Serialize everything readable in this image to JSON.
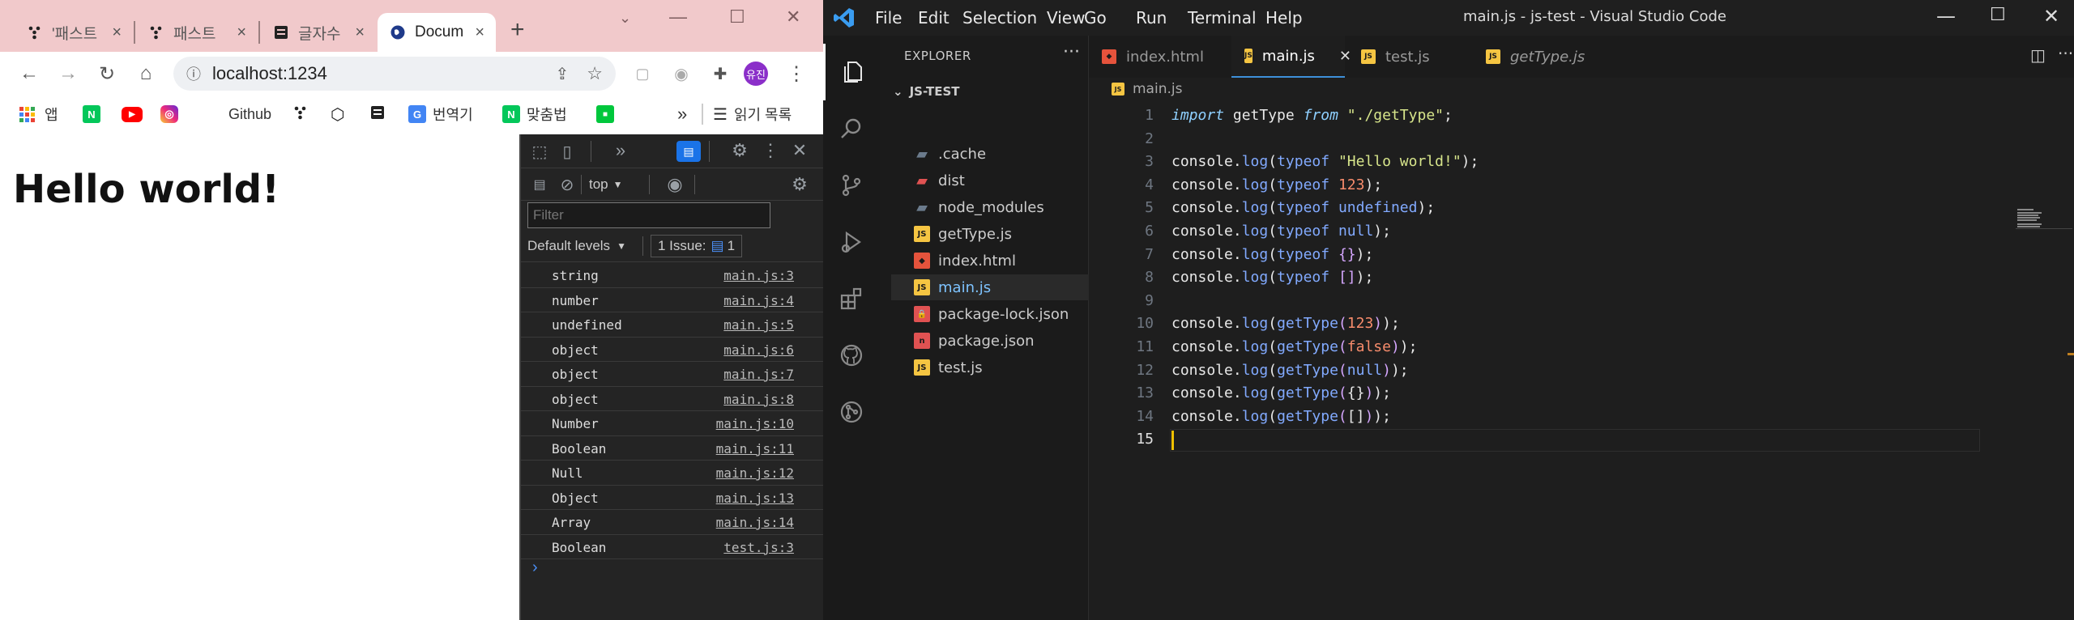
{
  "browser": {
    "tabs": [
      {
        "label": "'패스트",
        "active": false
      },
      {
        "label": "패스트",
        "active": false
      },
      {
        "label": "글자수",
        "active": false
      },
      {
        "label": "Docum",
        "active": true
      }
    ],
    "tab_close_glyph": "×",
    "new_tab_glyph": "+",
    "url": "localhost:1234",
    "profile_initials": "유진",
    "bookmarks": [
      {
        "label": "앱",
        "icon": "apps-grid-icon"
      },
      {
        "label": "",
        "icon": "naver-icon",
        "color": "#03c75a",
        "letter": "N"
      },
      {
        "label": "",
        "icon": "youtube-icon",
        "color": "#ff0000",
        "letter": "▶"
      },
      {
        "label": "",
        "icon": "instagram-icon",
        "color": "#d6249f",
        "letter": "◎"
      },
      {
        "label": "Github",
        "icon": "github-icon"
      },
      {
        "label": "",
        "icon": "fastcampus-icon"
      },
      {
        "label": "",
        "icon": "codepen-icon"
      },
      {
        "label": "",
        "icon": "bookmark-doc-icon"
      },
      {
        "label": "번역기",
        "icon": "google-translate-icon",
        "color": "#4285f4",
        "letter": "G"
      },
      {
        "label": "맞춤법",
        "icon": "naver-spell-icon",
        "color": "#03c75a",
        "letter": "N"
      },
      {
        "label": "",
        "icon": "extension-bag-icon",
        "color": "#00c73c",
        "letter": "■"
      },
      {
        "label": "»",
        "icon": "more-bookmarks-icon"
      },
      {
        "label": "읽기 목록",
        "icon": "reading-list-icon"
      }
    ]
  },
  "page": {
    "heading": "Hello world!"
  },
  "devtools": {
    "context": "top",
    "filter_placeholder": "Filter",
    "levels": "Default levels",
    "issues_label": "1 Issue:",
    "issues_count": "1",
    "console": [
      {
        "message": "string",
        "source": "main.js:3"
      },
      {
        "message": "number",
        "source": "main.js:4"
      },
      {
        "message": "undefined",
        "source": "main.js:5"
      },
      {
        "message": "object",
        "source": "main.js:6"
      },
      {
        "message": "object",
        "source": "main.js:7"
      },
      {
        "message": "object",
        "source": "main.js:8"
      },
      {
        "message": "Number",
        "source": "main.js:10"
      },
      {
        "message": "Boolean",
        "source": "main.js:11"
      },
      {
        "message": "Null",
        "source": "main.js:12"
      },
      {
        "message": "Object",
        "source": "main.js:13"
      },
      {
        "message": "Array",
        "source": "main.js:14"
      },
      {
        "message": "Boolean",
        "source": "test.js:3"
      }
    ],
    "prompt": "›"
  },
  "vscode": {
    "menu": [
      "File",
      "Edit",
      "Selection",
      "View",
      "Go",
      "Run",
      "Terminal",
      "Help"
    ],
    "window_title": "main.js - js-test - Visual Studio Code",
    "explorer_title": "EXPLORER",
    "project": "JS-TEST",
    "files": [
      {
        "name": ".cache",
        "type": "folder",
        "color": "#6b7b8c"
      },
      {
        "name": "dist",
        "type": "folder-dist",
        "color": "#e05252"
      },
      {
        "name": "node_modules",
        "type": "folder-node",
        "color": "#6b7b8c"
      },
      {
        "name": "getType.js",
        "type": "js",
        "color": "#f5c542"
      },
      {
        "name": "index.html",
        "type": "html",
        "color": "#e5533c"
      },
      {
        "name": "main.js",
        "type": "js",
        "color": "#f5c542",
        "selected": true
      },
      {
        "name": "package-lock.json",
        "type": "lock",
        "color": "#e05252"
      },
      {
        "name": "package.json",
        "type": "npm",
        "color": "#e05252"
      },
      {
        "name": "test.js",
        "type": "js",
        "color": "#f5c542"
      }
    ],
    "tabs": [
      {
        "name": "index.html",
        "type": "html",
        "active": false,
        "italic": false
      },
      {
        "name": "main.js",
        "type": "js",
        "active": true,
        "italic": false
      },
      {
        "name": "test.js",
        "type": "js",
        "active": false,
        "italic": false
      },
      {
        "name": "getType.js",
        "type": "js",
        "active": false,
        "italic": true
      }
    ],
    "tab_close_glyph": "✕",
    "breadcrumb": "main.js",
    "code": [
      {
        "n": "1",
        "tokens": [
          [
            "kw",
            "import"
          ],
          [
            "p",
            " getType "
          ],
          [
            "kw",
            "from"
          ],
          [
            "p",
            " "
          ],
          [
            "str",
            "\"./getType\""
          ],
          [
            "p",
            ";"
          ]
        ]
      },
      {
        "n": "2",
        "tokens": []
      },
      {
        "n": "3",
        "tokens": [
          [
            "p",
            "console."
          ],
          [
            "fn",
            "log"
          ],
          [
            "p",
            "("
          ],
          [
            "fn",
            "typeof"
          ],
          [
            "p",
            " "
          ],
          [
            "str",
            "\"Hello world!\""
          ],
          [
            "p",
            ");"
          ]
        ]
      },
      {
        "n": "4",
        "tokens": [
          [
            "p",
            "console."
          ],
          [
            "fn",
            "log"
          ],
          [
            "p",
            "("
          ],
          [
            "fn",
            "typeof"
          ],
          [
            "p",
            " "
          ],
          [
            "num",
            "123"
          ],
          [
            "p",
            ");"
          ]
        ]
      },
      {
        "n": "5",
        "tokens": [
          [
            "p",
            "console."
          ],
          [
            "fn",
            "log"
          ],
          [
            "p",
            "("
          ],
          [
            "fn",
            "typeof"
          ],
          [
            "p",
            " "
          ],
          [
            "fn",
            "undefined"
          ],
          [
            "p",
            ");"
          ]
        ]
      },
      {
        "n": "6",
        "tokens": [
          [
            "p",
            "console."
          ],
          [
            "fn",
            "log"
          ],
          [
            "p",
            "("
          ],
          [
            "fn",
            "typeof"
          ],
          [
            "p",
            " "
          ],
          [
            "fn",
            "null"
          ],
          [
            "p",
            ");"
          ]
        ]
      },
      {
        "n": "7",
        "tokens": [
          [
            "p",
            "console."
          ],
          [
            "fn",
            "log"
          ],
          [
            "p",
            "("
          ],
          [
            "fn",
            "typeof"
          ],
          [
            "p",
            " "
          ],
          [
            "br",
            "{}"
          ],
          [
            "p",
            ");"
          ]
        ]
      },
      {
        "n": "8",
        "tokens": [
          [
            "p",
            "console."
          ],
          [
            "fn",
            "log"
          ],
          [
            "p",
            "("
          ],
          [
            "fn",
            "typeof"
          ],
          [
            "p",
            " "
          ],
          [
            "br",
            "[]"
          ],
          [
            "p",
            ");"
          ]
        ]
      },
      {
        "n": "9",
        "tokens": []
      },
      {
        "n": "10",
        "tokens": [
          [
            "p",
            "console."
          ],
          [
            "fn",
            "log"
          ],
          [
            "p",
            "("
          ],
          [
            "fn",
            "getType"
          ],
          [
            "br",
            "("
          ],
          [
            "num",
            "123"
          ],
          [
            "br",
            ")"
          ],
          [
            "p",
            ");"
          ]
        ]
      },
      {
        "n": "11",
        "tokens": [
          [
            "p",
            "console."
          ],
          [
            "fn",
            "log"
          ],
          [
            "p",
            "("
          ],
          [
            "fn",
            "getType"
          ],
          [
            "br",
            "("
          ],
          [
            "num",
            "false"
          ],
          [
            "br",
            ")"
          ],
          [
            "p",
            ");"
          ]
        ]
      },
      {
        "n": "12",
        "tokens": [
          [
            "p",
            "console."
          ],
          [
            "fn",
            "log"
          ],
          [
            "p",
            "("
          ],
          [
            "fn",
            "getType"
          ],
          [
            "br",
            "("
          ],
          [
            "fn",
            "null"
          ],
          [
            "br",
            ")"
          ],
          [
            "p",
            ");"
          ]
        ]
      },
      {
        "n": "13",
        "tokens": [
          [
            "p",
            "console."
          ],
          [
            "fn",
            "log"
          ],
          [
            "p",
            "("
          ],
          [
            "fn",
            "getType"
          ],
          [
            "br",
            "("
          ],
          [
            "p",
            "{}"
          ],
          [
            "br",
            ")"
          ],
          [
            "p",
            ");"
          ]
        ]
      },
      {
        "n": "14",
        "tokens": [
          [
            "p",
            "console."
          ],
          [
            "fn",
            "log"
          ],
          [
            "p",
            "("
          ],
          [
            "fn",
            "getType"
          ],
          [
            "br",
            "("
          ],
          [
            "p",
            "[]"
          ],
          [
            "br",
            ")"
          ],
          [
            "p",
            ");"
          ]
        ]
      },
      {
        "n": "15",
        "tokens": []
      }
    ]
  }
}
